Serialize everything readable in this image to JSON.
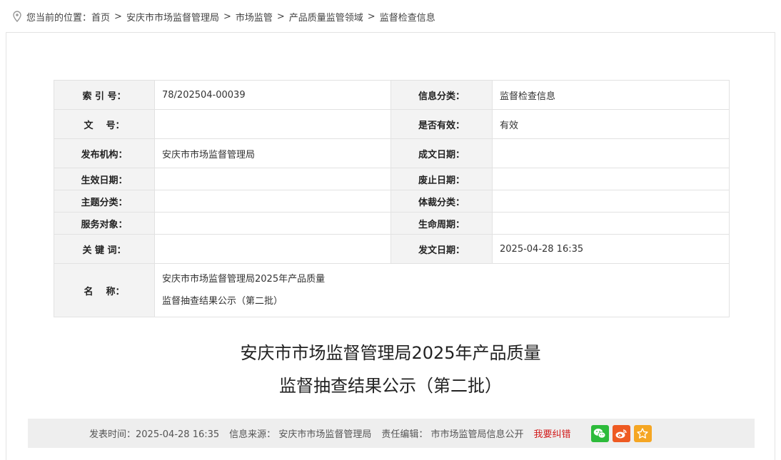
{
  "breadcrumb": {
    "prefix": "您当前的位置：",
    "items": [
      "首页",
      "安庆市市场监督管理局",
      "市场监管",
      "产品质量监管领域",
      "监督检查信息"
    ],
    "separator": ">"
  },
  "meta": {
    "index_label": "索 引 号：",
    "index_value": "78/202504-00039",
    "category_label": "信息分类：",
    "category_value": "监督检查信息",
    "docno_label": "文    号：",
    "docno_value": "",
    "valid_label": "是否有效：",
    "valid_value": "有效",
    "publisher_label": "发布机构：",
    "publisher_value": "安庆市市场监督管理局",
    "written_label": "成文日期：",
    "written_value": "",
    "effective_label": "生效日期：",
    "effective_value": "",
    "abolish_label": "废止日期：",
    "abolish_value": "",
    "topic_label": "主题分类：",
    "topic_value": "",
    "genre_label": "体裁分类：",
    "genre_value": "",
    "service_label": "服务对象：",
    "service_value": "",
    "lifecycle_label": "生命周期：",
    "lifecycle_value": "",
    "keywords_label": "关 键 词：",
    "keywords_value": "",
    "pubdate_label": "发文日期：",
    "pubdate_value": "2025-04-28 16:35",
    "name_label": "名    称：",
    "name_line1": "安庆市市场监督管理局2025年产品质量",
    "name_line2": "监督抽查结果公示（第二批）"
  },
  "article": {
    "title_line1": "安庆市市场监督管理局2025年产品质量",
    "title_line2": "监督抽查结果公示（第二批）"
  },
  "info_bar": {
    "time_label": "发表时间：",
    "time_value": "2025-04-28 16:35",
    "source_label": "信息来源：",
    "source_value": "安庆市市场监督管理局",
    "editor_label": "责任编辑：",
    "editor_value": "市市场监管局信息公开",
    "error_link": "我要纠错",
    "share": [
      {
        "icon": "wechat-icon",
        "color": "#2dbb3b"
      },
      {
        "icon": "weibo-icon",
        "color": "#ee5a22"
      },
      {
        "icon": "favorite-star-icon",
        "color": "#f5a623"
      }
    ]
  }
}
